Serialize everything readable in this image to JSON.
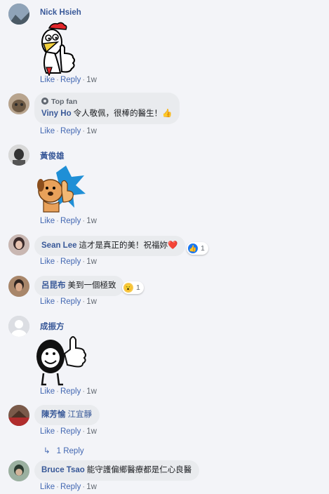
{
  "comments": [
    {
      "name": "Nick Hsieh",
      "text": "",
      "sticker": "rooster-thumbs-up-sticker"
    },
    {
      "name": "Viny Ho",
      "badge": "Top fan",
      "text": "令人敬佩，很棒的醫生！👍"
    },
    {
      "name": "黃俊雄",
      "text": "",
      "sticker": "dog-thumbs-up-sticker"
    },
    {
      "name": "Sean Lee",
      "text": "這才是真正的美！祝福妳❤️",
      "reaction": {
        "icon": "like-reaction-icon",
        "count": "1"
      }
    },
    {
      "name": "呂昆布",
      "text": "美到一個極致",
      "reaction": {
        "icon": "wow-reaction-icon",
        "count": "1"
      }
    },
    {
      "name": "成振方",
      "text": "",
      "sticker": "blob-thumbs-up-sticker"
    },
    {
      "name": "陳芳愉",
      "text": "江宜靜",
      "replies": "1 Reply"
    },
    {
      "name": "Bruce Tsao",
      "text": "能守護偏鄉醫療都是仁心良醫"
    }
  ],
  "actions": {
    "like": "Like",
    "reply": "Reply",
    "time": "1w",
    "separator": "·"
  },
  "colors": {
    "name": "#385898",
    "link": "#4267b2",
    "bubble": "#e9ebee",
    "like_blue": "#1877f2"
  }
}
